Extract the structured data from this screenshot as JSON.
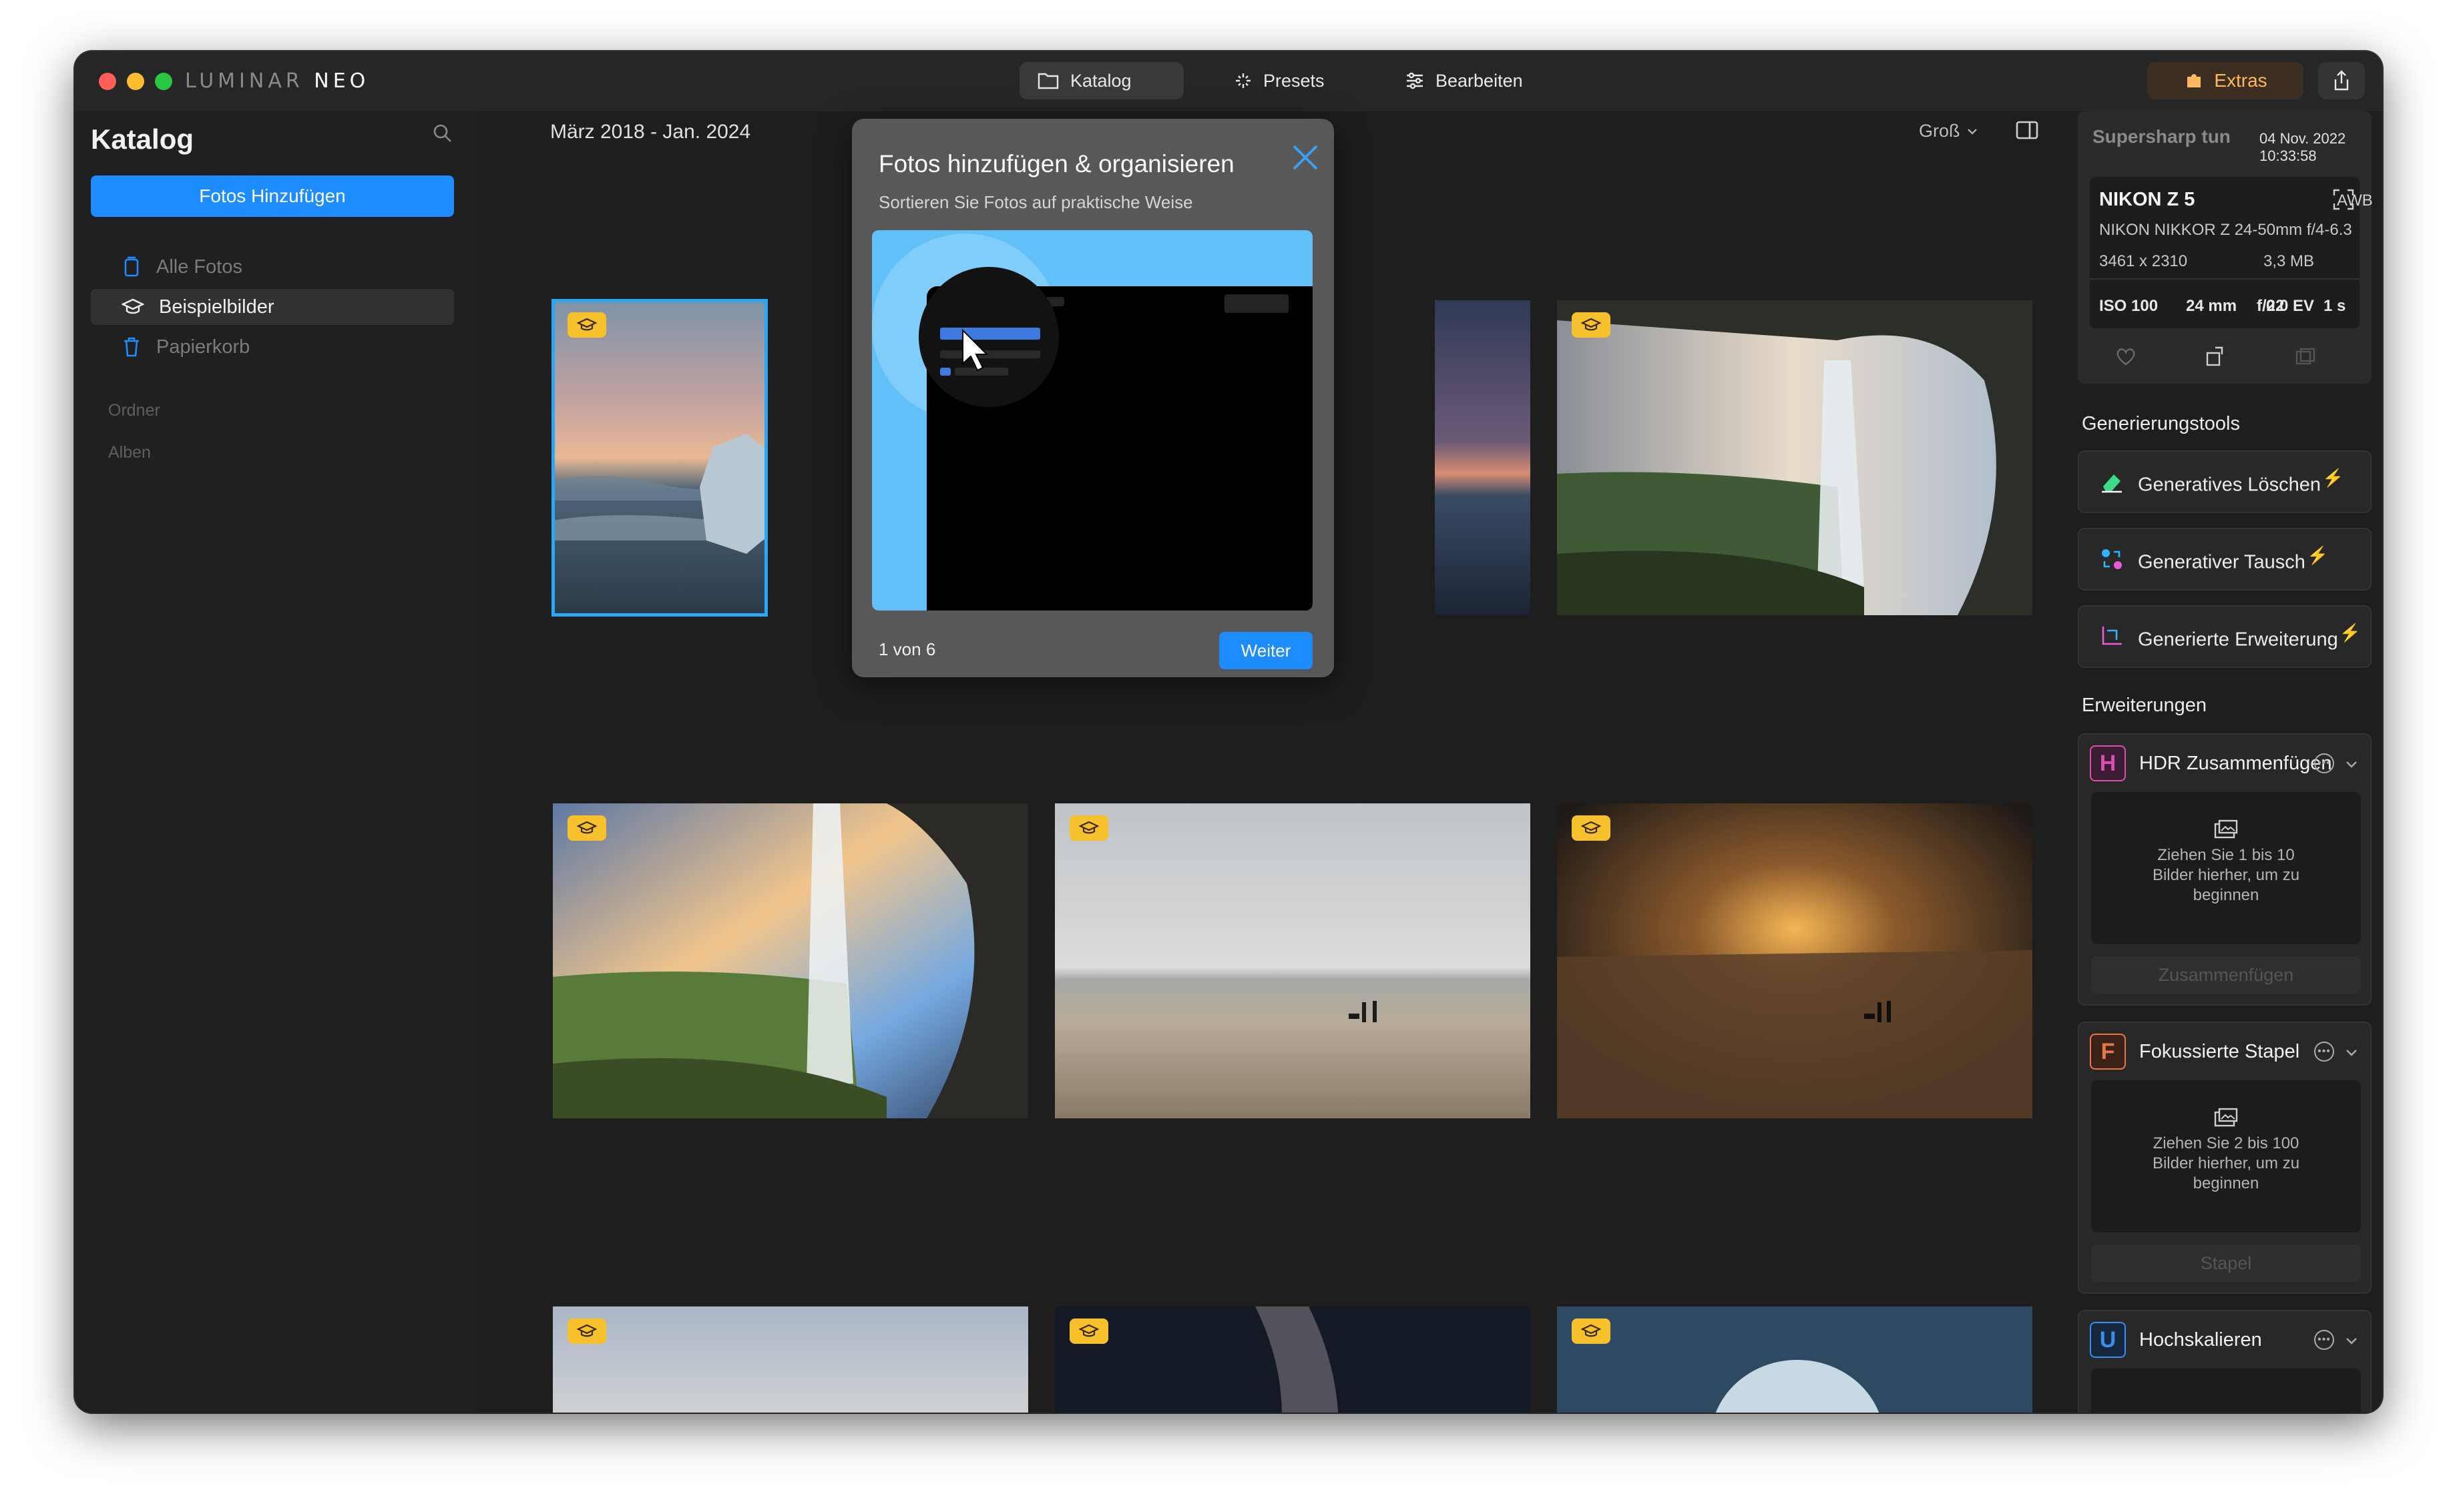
{
  "app": {
    "logo_a": "LUMINAR",
    "logo_b": "NEO",
    "colors": {
      "accent": "#1d8cff",
      "selection": "#2aa8f6",
      "extras": "#ffb85f",
      "badge": "#f6c12c",
      "lightning": "#ffc21d"
    }
  },
  "toolbar": {
    "tabs": [
      {
        "label": "Katalog",
        "icon": "folder-icon",
        "active": true
      },
      {
        "label": "Presets",
        "icon": "presets-icon",
        "active": false
      },
      {
        "label": "Bearbeiten",
        "icon": "sliders-icon",
        "active": false
      }
    ],
    "extras_label": "Extras",
    "share_icon": "share-icon"
  },
  "sidebar": {
    "title": "Katalog",
    "add_button": "Fotos Hinzufügen",
    "items": [
      {
        "label": "Alle Fotos",
        "icon": "photos-icon",
        "selected": false
      },
      {
        "label": "Beispielbilder",
        "icon": "graduation-cap-icon",
        "selected": true
      },
      {
        "label": "Papierkorb",
        "icon": "trash-icon",
        "selected": false
      }
    ],
    "sections": [
      "Ordner",
      "Alben"
    ]
  },
  "grid": {
    "date_range": "März 2018 - Jan. 2024",
    "size_label": "Groß",
    "photos": [
      {
        "scene": "ice-beach",
        "badge": "graduation-cap-icon",
        "selected": true
      },
      {
        "scene": "seascape-dusk",
        "badge": "graduation-cap-icon",
        "selected": false
      },
      {
        "scene": "waterfall-cave",
        "badge": "graduation-cap-icon",
        "selected": false
      },
      {
        "scene": "waterfall-sunset",
        "badge": "graduation-cap-icon",
        "selected": false
      },
      {
        "scene": "beach-overcast",
        "badge": "graduation-cap-icon",
        "selected": false
      },
      {
        "scene": "beach-sunset",
        "badge": "graduation-cap-icon",
        "selected": false
      },
      {
        "scene": "rocks-sky",
        "badge": "graduation-cap-icon",
        "selected": false
      },
      {
        "scene": "milky-way",
        "badge": "graduation-cap-icon",
        "selected": false
      },
      {
        "scene": "ice-cave",
        "badge": "graduation-cap-icon",
        "selected": false
      }
    ]
  },
  "modal": {
    "title": "Fotos hinzufügen & organisieren",
    "subtitle": "Sortieren Sie Fotos auf praktische Weise",
    "count": "1 von 6",
    "next": "Weiter"
  },
  "info": {
    "title": "Supersharp tun",
    "date": "04 Nov. 2022 10:33:58",
    "camera": "NIKON Z 5",
    "wb": "AWB",
    "lens": "NIKON NIKKOR Z 24-50mm f/4-6.3",
    "dimensions": "3461 x 2310",
    "filesize": "3,3 MB",
    "iso": "ISO 100",
    "focal": "24 mm",
    "ev": "0.0 EV",
    "aperture": "f/22",
    "shutter": "1 s"
  },
  "gen_tools": {
    "header": "Generierungstools",
    "items": [
      {
        "label": "Generatives Löschen",
        "icon": "eraser-icon"
      },
      {
        "label": "Generativer Tausch",
        "icon": "swap-icon"
      },
      {
        "label": "Generierte Erweiterung",
        "icon": "expand-icon"
      }
    ]
  },
  "extensions": {
    "header": "Erweiterungen",
    "items": [
      {
        "letter": "H",
        "label": "HDR Zusammenfügen",
        "drop_line1": "Ziehen Sie 1 bis 10",
        "drop_line2": "Bilder hierher, um zu",
        "drop_line3": "beginnen",
        "button": "Zusammenfügen",
        "color": "#d94fb0"
      },
      {
        "letter": "F",
        "label": "Fokussierte Stapel",
        "drop_line1": "Ziehen Sie 2 bis 100",
        "drop_line2": "Bilder hierher, um zu",
        "drop_line3": "beginnen",
        "button": "Stapel",
        "color": "#e8784a"
      },
      {
        "letter": "U",
        "label": "Hochskalieren",
        "color": "#3b8ef0"
      }
    ]
  }
}
